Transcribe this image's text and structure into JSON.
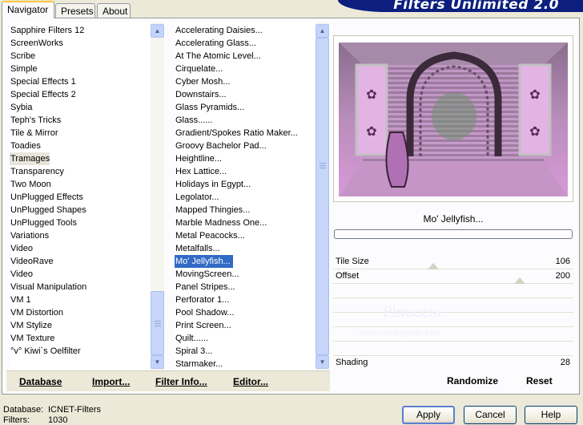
{
  "tabs": [
    "Navigator",
    "Presets",
    "About"
  ],
  "banner": "Filters Unlimited 2.0",
  "categories": {
    "items": [
      "Sapphire Filters 12",
      "ScreenWorks",
      "Scribe",
      "Simple",
      "Special Effects 1",
      "Special Effects 2",
      "Sybia",
      "Teph's Tricks",
      "Tile & Mirror",
      "Toadies",
      "Tramages",
      "Transparency",
      "Two Moon",
      "UnPlugged Effects",
      "UnPlugged Shapes",
      "UnPlugged Tools",
      "Variations",
      "Video",
      "VideoRave",
      "Video",
      "Visual Manipulation",
      "VM 1",
      "VM Distortion",
      "VM Stylize",
      "VM Texture",
      "°v° Kiwi`s Oelfilter"
    ],
    "selected": "Tramages"
  },
  "filters": {
    "items": [
      "Accelerating Daisies...",
      "Accelerating Glass...",
      "At The Atomic Level...",
      "Cirquelate...",
      "Cyber Mosh...",
      "Downstairs...",
      "Glass Pyramids...",
      "Glass......",
      "Gradient/Spokes Ratio Maker...",
      "Groovy Bachelor Pad...",
      "Heightline...",
      "Hex Lattice...",
      "Holidays in Egypt...",
      "Legolator...",
      "Mapped Thingies...",
      "Marble Madness One...",
      "Metal Peacocks...",
      "Metalfalls...",
      "Mo' Jellyfish...",
      "MovingScreen...",
      "Panel Stripes...",
      "Perforator 1...",
      "Pool Shadow...",
      "Print Screen...",
      "Quilt......",
      "Spiral 3...",
      "Starmaker..."
    ],
    "selected": "Mo' Jellyfish..."
  },
  "bottom_buttons": {
    "database": "Database",
    "import": "Import...",
    "filter_info": "Filter Info...",
    "editor": "Editor..."
  },
  "preview": {
    "filter_name": "Mo' Jellyfish...",
    "watermark_name": "Pinuccia",
    "watermark_url": "www.maidiregrafica.eu"
  },
  "params": [
    {
      "label": "Tile Size",
      "value": "106"
    },
    {
      "label": "Offset",
      "value": "200"
    },
    {
      "label": "Shading",
      "value": "28"
    }
  ],
  "actions": {
    "randomize": "Randomize",
    "reset": "Reset"
  },
  "status": {
    "database_label": "Database:",
    "database_value": "ICNET-Filters",
    "filters_label": "Filters:",
    "filters_value": "1030"
  },
  "dialog": {
    "apply": "Apply",
    "cancel": "Cancel",
    "help": "Help"
  },
  "colors": {
    "selection": "#316ac5",
    "banner": "#0c1f7f",
    "preview_pink": "#d08ed6"
  }
}
